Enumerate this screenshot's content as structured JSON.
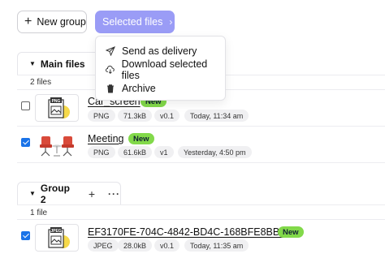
{
  "toolbar": {
    "new_group_label": "New group",
    "selected_files_label": "Selected files"
  },
  "menu": {
    "items": [
      {
        "label": "Send as delivery",
        "icon": "send-icon"
      },
      {
        "label": "Download selected files",
        "icon": "download-cloud-icon"
      },
      {
        "label": "Archive",
        "icon": "trash-icon"
      }
    ]
  },
  "groups": [
    {
      "name": "Main files",
      "count": "2 files",
      "files": [
        {
          "name": "Car_screen",
          "badge": "New",
          "type": "PNG",
          "size": "71.3kB",
          "version": "v0.1",
          "date": "Today, 11:34 am",
          "checked": false,
          "thumb_label": "PNG"
        },
        {
          "name": "Meeting",
          "badge": "New",
          "type": "PNG",
          "size": "61.6kB",
          "version": "v1",
          "date": "Yesterday, 4:50 pm",
          "checked": true
        }
      ]
    },
    {
      "name": "Group 2",
      "count": "1 file",
      "files": [
        {
          "name": "EF3170FE-704C-4842-BD4C-168BFE8BBD84",
          "badge": "New",
          "type": "JPEG",
          "size": "28.0kB",
          "version": "v0.1",
          "date": "Today, 11:35 am",
          "checked": true,
          "thumb_label": "JPEG"
        }
      ]
    }
  ],
  "colors": {
    "accent": "#9a9cf6",
    "badge_new": "#82d94a",
    "checkbox": "#1a73e8"
  }
}
